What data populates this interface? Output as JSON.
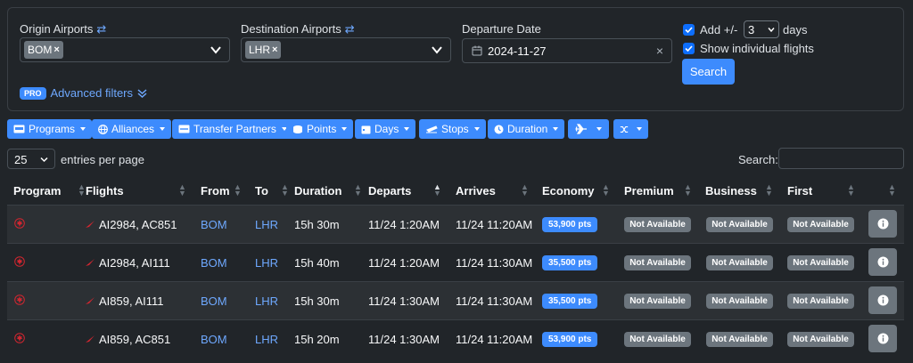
{
  "search": {
    "origin_label": "Origin Airports",
    "origin_tag": "BOM",
    "dest_label": "Destination Airports",
    "dest_tag": "LHR",
    "date_label": "Departure Date",
    "date_value": "2024-11-27",
    "add_label": "Add +/-",
    "add_value": "3",
    "days_label": "days",
    "show_individual_label": "Show individual flights",
    "search_button": "Search",
    "pro_badge": "PRO",
    "advanced_filters": "Advanced filters"
  },
  "filters": [
    {
      "label": "Programs",
      "icon": "card-icon"
    },
    {
      "label": "Alliances",
      "icon": "globe-icon"
    },
    {
      "label": "Transfer Partners",
      "icon": "transfer-icon"
    },
    {
      "label": "Points",
      "icon": "coins-icon"
    },
    {
      "label": "Days",
      "icon": "calendar-icon"
    },
    {
      "label": "Stops",
      "icon": "plane-departure-icon"
    },
    {
      "label": "Duration",
      "icon": "clock-icon"
    },
    {
      "label": "",
      "icon": "plane-icon"
    },
    {
      "label": "",
      "icon": "shuffle-icon"
    }
  ],
  "table_controls": {
    "page_size": "25",
    "entries_label": "entries per page",
    "search_label": "Search:"
  },
  "columns": [
    "Program",
    "Flights",
    "From",
    "To",
    "Duration",
    "Departs",
    "Arrives",
    "Economy",
    "Premium",
    "Business",
    "First"
  ],
  "rows": [
    {
      "flights": "AI2984, AC851",
      "from": "BOM",
      "to": "LHR",
      "duration": "15h 30m",
      "departs": "11/24 1:20AM",
      "arrives": "11/24 11:20AM",
      "economy": "53,900 pts",
      "premium": "Not Available",
      "business": "Not Available",
      "first": "Not Available"
    },
    {
      "flights": "AI2984, AI111",
      "from": "BOM",
      "to": "LHR",
      "duration": "15h 40m",
      "departs": "11/24 1:20AM",
      "arrives": "11/24 11:30AM",
      "economy": "35,500 pts",
      "premium": "Not Available",
      "business": "Not Available",
      "first": "Not Available"
    },
    {
      "flights": "AI859, AI111",
      "from": "BOM",
      "to": "LHR",
      "duration": "15h 30m",
      "departs": "11/24 1:30AM",
      "arrives": "11/24 11:30AM",
      "economy": "35,500 pts",
      "premium": "Not Available",
      "business": "Not Available",
      "first": "Not Available"
    },
    {
      "flights": "AI859, AC851",
      "from": "BOM",
      "to": "LHR",
      "duration": "15h 20m",
      "departs": "11/24 1:30AM",
      "arrives": "11/24 11:20AM",
      "economy": "53,900 pts",
      "premium": "Not Available",
      "business": "Not Available",
      "first": "Not Available"
    }
  ],
  "colors": {
    "accent": "#3d8bfd",
    "link": "#6ea8fe",
    "badge_gray": "#6c757d",
    "background": "#212529",
    "airline_red": "#d22630"
  }
}
